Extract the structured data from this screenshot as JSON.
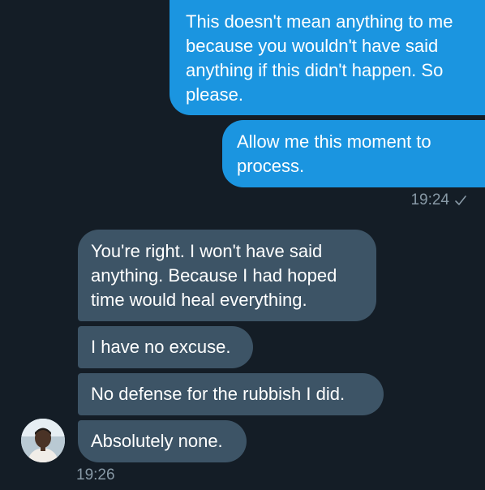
{
  "conversation": {
    "outgoing": [
      {
        "text": "This doesn't mean anything to me because you wouldn't have said anything if this didn't happen. So please."
      },
      {
        "text": "Allow me this moment to process."
      }
    ],
    "outgoing_time": "19:24",
    "incoming": [
      {
        "text": "You're right. I won't have said anything. Because I had hoped time would heal everything."
      },
      {
        "text": "I have no excuse."
      },
      {
        "text": "No defense for the rubbish I did."
      },
      {
        "text": "Absolutely none."
      }
    ],
    "incoming_time": "19:26"
  },
  "icons": {
    "read_receipt": "check-icon",
    "sender_avatar": "avatar"
  },
  "colors": {
    "background": "#141d26",
    "outgoing_bubble": "#1b95e0",
    "incoming_bubble": "#3d5466",
    "timestamp": "#8899a6"
  }
}
